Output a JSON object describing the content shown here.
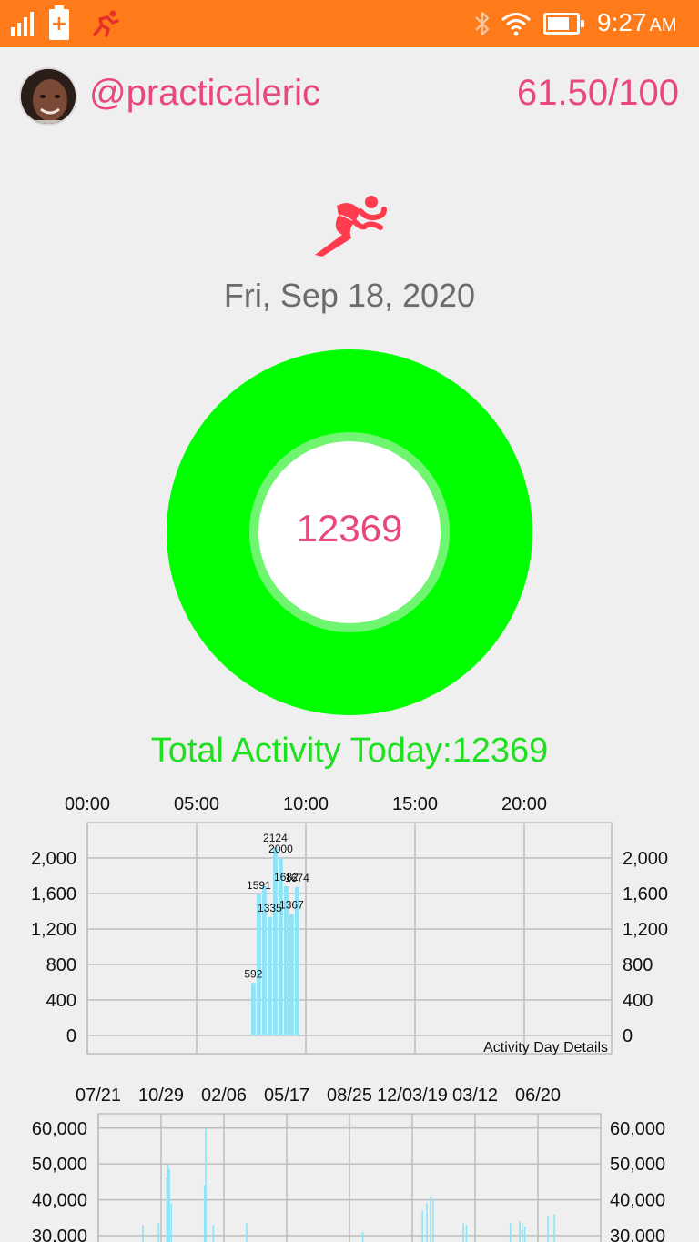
{
  "status_bar": {
    "time": "9:27",
    "ampm": "AM",
    "battery_level": 0.78,
    "icons": [
      "signal-icon",
      "battery-charging-icon",
      "running-app-icon",
      "bluetooth-icon",
      "wifi-icon",
      "battery-icon"
    ]
  },
  "profile": {
    "username": "@practicaleric",
    "score": "61.50/100"
  },
  "date": "Fri, Sep 18, 2020",
  "ring": {
    "value": "12369",
    "color": "#00ff00"
  },
  "total_activity": "Total Activity Today:12369",
  "colors": {
    "accent": "#e8497a",
    "status_bar": "#ff7b1a",
    "ring": "#00ff00",
    "total_text": "#1fe01f",
    "bars": "#8fe3f7"
  },
  "chart_data": [
    {
      "type": "bar",
      "title": "Activity Day Details",
      "x_unit": "hour",
      "x_ticks": [
        "00:00",
        "05:00",
        "10:00",
        "15:00",
        "20:00"
      ],
      "x_range": [
        0,
        24
      ],
      "y_ticks": [
        "0",
        "400",
        "800",
        "1,200",
        "1,600",
        "2,000"
      ],
      "ylim": [
        0,
        2400
      ],
      "grid": true,
      "points": [
        {
          "hour": 7.5,
          "value": 592,
          "label": "592"
        },
        {
          "hour": 7.75,
          "value": 1591,
          "label": "1591"
        },
        {
          "hour": 8.0,
          "value": 1682,
          "label": ""
        },
        {
          "hour": 8.25,
          "value": 1335,
          "label": "1335"
        },
        {
          "hour": 8.5,
          "value": 2124,
          "label": "2124"
        },
        {
          "hour": 8.75,
          "value": 2000,
          "label": "2000"
        },
        {
          "hour": 9.0,
          "value": 1682,
          "label": "1682"
        },
        {
          "hour": 9.25,
          "value": 1367,
          "label": "1367"
        },
        {
          "hour": 9.5,
          "value": 1674,
          "label": "1674"
        }
      ]
    },
    {
      "type": "bar",
      "x_ticks": [
        "07/21",
        "10/29",
        "02/06",
        "05/17",
        "08/25",
        "12/03/19",
        "03/12",
        "06/20"
      ],
      "y_ticks": [
        "30,000",
        "40,000",
        "50,000",
        "60,000"
      ],
      "ylim": [
        30000,
        64000
      ],
      "grid": true,
      "points": [
        {
          "x": 0.7,
          "value": 33000
        },
        {
          "x": 0.95,
          "value": 33500
        },
        {
          "x": 1.08,
          "value": 46000
        },
        {
          "x": 1.1,
          "value": 50000
        },
        {
          "x": 1.12,
          "value": 48500
        },
        {
          "x": 1.15,
          "value": 39000
        },
        {
          "x": 1.7,
          "value": 60000
        },
        {
          "x": 1.68,
          "value": 44000
        },
        {
          "x": 1.82,
          "value": 33000
        },
        {
          "x": 2.35,
          "value": 33500
        },
        {
          "x": 4.2,
          "value": 31000
        },
        {
          "x": 5.15,
          "value": 37000
        },
        {
          "x": 5.22,
          "value": 39000
        },
        {
          "x": 5.28,
          "value": 41000
        },
        {
          "x": 5.32,
          "value": 40500
        },
        {
          "x": 5.8,
          "value": 33500
        },
        {
          "x": 5.85,
          "value": 33000
        },
        {
          "x": 6.55,
          "value": 33500
        },
        {
          "x": 6.7,
          "value": 34000
        },
        {
          "x": 6.74,
          "value": 33500
        },
        {
          "x": 6.78,
          "value": 32500
        },
        {
          "x": 7.15,
          "value": 35500
        },
        {
          "x": 7.25,
          "value": 36000
        }
      ]
    }
  ]
}
